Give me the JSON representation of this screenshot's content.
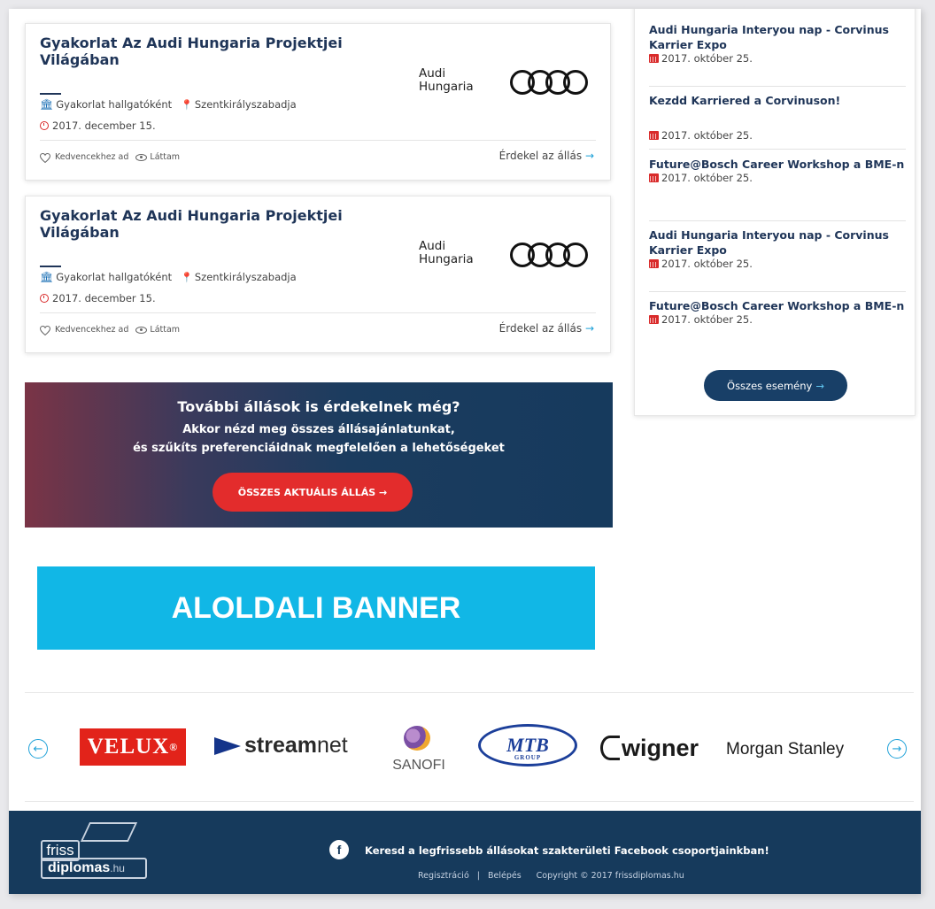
{
  "jobs": [
    {
      "title": "Gyakorlat Az Audi Hungaria Projektjei Világában",
      "type": "Gyakorlat hallgatóként",
      "location": "Szentkirályszabadja",
      "date": "2017. december 15.",
      "company_line1": "Audi",
      "company_line2": "Hungaria",
      "favorite_label": "Kedvencekhez ad",
      "seen_label": "Láttam",
      "interest_label": "Érdekel az állás",
      "arrow": "→"
    },
    {
      "title": "Gyakorlat Az Audi Hungaria Projektjei Világában",
      "type": "Gyakorlat hallgatóként",
      "location": "Szentkirályszabadja",
      "date": "2017. december 15.",
      "company_line1": "Audi",
      "company_line2": "Hungaria",
      "favorite_label": "Kedvencekhez ad",
      "seen_label": "Láttam",
      "interest_label": "Érdekel az állás",
      "arrow": "→"
    }
  ],
  "events": {
    "items": [
      {
        "title": "Audi Hungaria Interyou nap - Corvinus Karrier Expo",
        "date": "2017. október 25."
      },
      {
        "title": "Kezdd Karriered a Corvinuson!",
        "date": "2017. október 25."
      },
      {
        "title": "Future@Bosch Career Workshop a BME-n",
        "date": "2017. október 25."
      },
      {
        "title": "Audi Hungaria Interyou nap - Corvinus Karrier Expo",
        "date": "2017. október 25."
      },
      {
        "title": "Future@Bosch Career Workshop a BME-n",
        "date": "2017. október 25."
      }
    ],
    "all_button": "Összes esemény",
    "arrow": "→"
  },
  "promo": {
    "heading": "További állások is érdekelnek még?",
    "line1": "Akkor nézd meg összes állásajánlatunkat,",
    "line2": "és szűkíts preferenciáidnak megfelelően a lehetőségeket",
    "button": "ÖSSZES AKTUÁLIS ÁLLÁS →"
  },
  "ad_banner": "ALOLDALI BANNER",
  "partners": {
    "prev": "←",
    "next": "→",
    "velux": "VELUX",
    "velux_dot": "®",
    "streamnet_bold": "stream",
    "streamnet_rest": "net",
    "sanofi": "SANOFI",
    "mtb": "MTB",
    "mtb_sub": "GROUP",
    "wigner": "wigner",
    "morgan": "Morgan Stanley"
  },
  "footer": {
    "logo_top": "friss",
    "logo_bottom": "diplomas",
    "logo_tld": ".hu",
    "fb_letter": "f",
    "fb_text": "Keresd a legfrissebb állásokat szakterületi Facebook csoportjainkban!",
    "register": "Regisztráció",
    "separator": "|",
    "login": "Belépés",
    "copyright": "Copyright © 2017 frissdiplomas.hu"
  },
  "colors": {
    "navy": "#163a5c",
    "title_navy": "#1f3558",
    "accent_blue": "#1ea1d8",
    "red": "#e32c2c",
    "banner_cyan": "#11b7e6"
  }
}
